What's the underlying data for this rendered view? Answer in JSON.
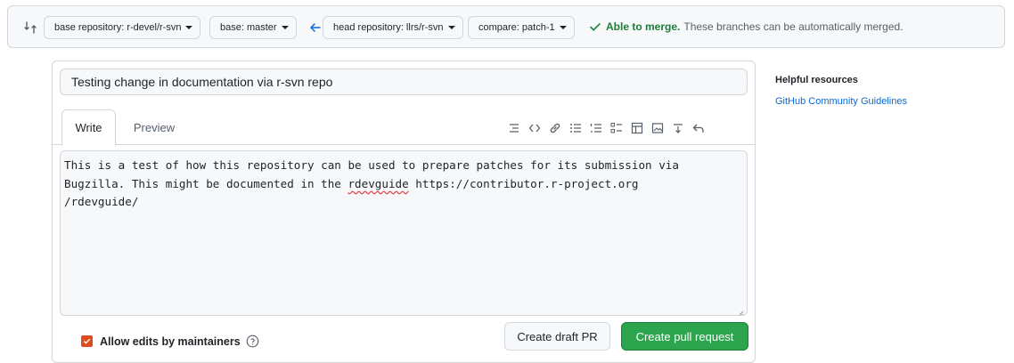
{
  "compare": {
    "icon": "git-compare-icon",
    "base_repository": "base repository: r-devel/r-svn",
    "base": "base: master",
    "head_repository": "head repository: llrs/r-svn",
    "compare": "compare: patch-1",
    "merge_status": "Able to merge.",
    "merge_message": "These branches can be automatically merged.",
    "status_color": "#1a7f37"
  },
  "pr": {
    "title_value": "Testing change in documentation via r-svn repo",
    "tabs": [
      "Write",
      "Preview"
    ],
    "toolbar_icons": [
      "heading-icon",
      "code-icon",
      "link-icon",
      "unordered-list-icon",
      "ordered-list-icon",
      "task-list-icon",
      "table-icon",
      "image-icon",
      "mention-icon",
      "reply-icon"
    ],
    "body_before": "This is a test of how this repository can be used to prepare patches for its submission via\nBugzilla. This might be documented in the ",
    "body_misspelled": "rdevguide",
    "body_after": " https://contributor.r-project.org\n/rdevguide/",
    "allow_edits_label": "Allow edits by maintainers",
    "draft_button": "Create draft PR",
    "create_button": "Create pull request",
    "accent_color": "#2da44e"
  },
  "sidebar": {
    "title": "Helpful resources",
    "link": "GitHub Community Guidelines"
  }
}
